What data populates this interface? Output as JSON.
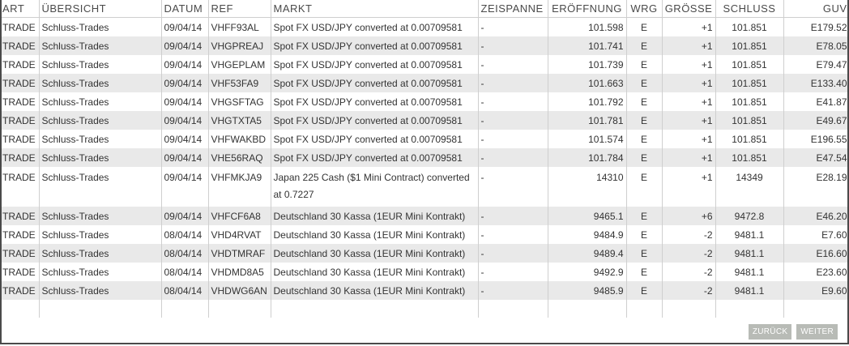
{
  "table": {
    "headers": [
      "ART",
      "ÜBERSICHT",
      "DATUM",
      "REF",
      "MARKT",
      "ZEISPANNE",
      "ERÖFFNUNG",
      "WRG",
      "GRÖSSE",
      "SCHLUSS",
      "GUV"
    ],
    "rows": [
      [
        "TRADE",
        "Schluss-Trades",
        "09/04/14",
        "VHFF93AL",
        "Spot FX USD/JPY converted at 0.00709581",
        "-",
        "101.598",
        "E",
        "+1",
        "101.851",
        "E179.52"
      ],
      [
        "TRADE",
        "Schluss-Trades",
        "09/04/14",
        "VHGPREAJ",
        "Spot FX USD/JPY converted at 0.00709581",
        "-",
        "101.741",
        "E",
        "+1",
        "101.851",
        "E78.05"
      ],
      [
        "TRADE",
        "Schluss-Trades",
        "09/04/14",
        "VHGEPLAM",
        "Spot FX USD/JPY converted at 0.00709581",
        "-",
        "101.739",
        "E",
        "+1",
        "101.851",
        "E79.47"
      ],
      [
        "TRADE",
        "Schluss-Trades",
        "09/04/14",
        "VHF53FA9",
        "Spot FX USD/JPY converted at 0.00709581",
        "-",
        "101.663",
        "E",
        "+1",
        "101.851",
        "E133.40"
      ],
      [
        "TRADE",
        "Schluss-Trades",
        "09/04/14",
        "VHGSFTAG",
        "Spot FX USD/JPY converted at 0.00709581",
        "-",
        "101.792",
        "E",
        "+1",
        "101.851",
        "E41.87"
      ],
      [
        "TRADE",
        "Schluss-Trades",
        "09/04/14",
        "VHGTXTA5",
        "Spot FX USD/JPY converted at 0.00709581",
        "-",
        "101.781",
        "E",
        "+1",
        "101.851",
        "E49.67"
      ],
      [
        "TRADE",
        "Schluss-Trades",
        "09/04/14",
        "VHFWAKBD",
        "Spot FX USD/JPY converted at 0.00709581",
        "-",
        "101.574",
        "E",
        "+1",
        "101.851",
        "E196.55"
      ],
      [
        "TRADE",
        "Schluss-Trades",
        "09/04/14",
        "VHE56RAQ",
        "Spot FX USD/JPY converted at 0.00709581",
        "-",
        "101.784",
        "E",
        "+1",
        "101.851",
        "E47.54"
      ],
      [
        "TRADE",
        "Schluss-Trades",
        "09/04/14",
        "VHFMKJA9",
        "Japan 225 Cash ($1 Mini Contract) converted at 0.7227",
        "-",
        "14310",
        "E",
        "+1",
        "14349",
        "E28.19"
      ],
      [
        "TRADE",
        "Schluss-Trades",
        "09/04/14",
        "VHFCF6A8",
        "Deutschland 30 Kassa (1EUR Mini Kontrakt)",
        "-",
        "9465.1",
        "E",
        "+6",
        "9472.8",
        "E46.20"
      ],
      [
        "TRADE",
        "Schluss-Trades",
        "08/04/14",
        "VHD4RVAT",
        "Deutschland 30 Kassa (1EUR Mini Kontrakt)",
        "-",
        "9484.9",
        "E",
        "-2",
        "9481.1",
        "E7.60"
      ],
      [
        "TRADE",
        "Schluss-Trades",
        "08/04/14",
        "VHDTMRAF",
        "Deutschland 30 Kassa (1EUR Mini Kontrakt)",
        "-",
        "9489.4",
        "E",
        "-2",
        "9481.1",
        "E16.60"
      ],
      [
        "TRADE",
        "Schluss-Trades",
        "08/04/14",
        "VHDMD8A5",
        "Deutschland 30 Kassa (1EUR Mini Kontrakt)",
        "-",
        "9492.9",
        "E",
        "-2",
        "9481.1",
        "E23.60"
      ],
      [
        "TRADE",
        "Schluss-Trades",
        "08/04/14",
        "VHDWG6AN",
        "Deutschland 30 Kassa (1EUR Mini Kontrakt)",
        "-",
        "9485.9",
        "E",
        "-2",
        "9481.1",
        "E9.60"
      ]
    ]
  },
  "pager": {
    "back_label": "ZURÜCK",
    "next_label": "WEITER"
  },
  "colors": {
    "row_alt": "#e9e9e9",
    "button_bg": "#b8bbb6",
    "frame_border": "#4a4a4a"
  }
}
